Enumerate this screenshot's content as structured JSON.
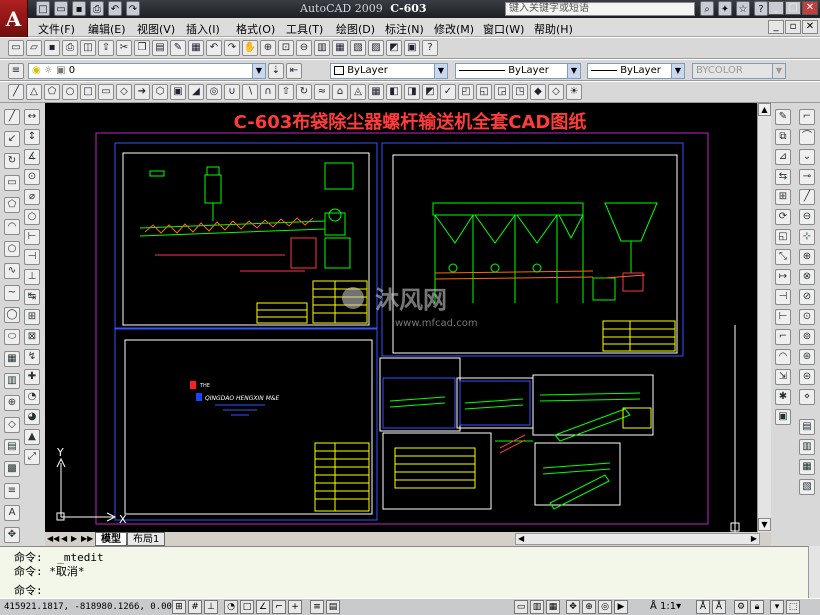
{
  "window": {
    "app_title": "AutoCAD 2009",
    "doc_title": "C-603",
    "search_placeholder": "键入关键字或短语",
    "logo": "A"
  },
  "menu": [
    "文件(F)",
    "编辑(E)",
    "视图(V)",
    "插入(I)",
    "格式(O)",
    "工具(T)",
    "绘图(D)",
    "标注(N)",
    "修改(M)",
    "窗口(W)",
    "帮助(H)"
  ],
  "layer_toolbar": {
    "layer_value": "0",
    "color_value": "ByLayer",
    "linetype_value": "ByLayer",
    "lineweight_value": "ByLayer",
    "plotstyle_value": "BYCOLOR"
  },
  "drawing": {
    "title": "C-603布袋除尘器螺杆输送机全套CAD图纸",
    "company": "QINGDAO HENGXIN M&E",
    "company_prefix": "THE",
    "watermark_brand": "沐风网",
    "watermark_url": "www.mfcad.com",
    "ucs_x": "X",
    "ucs_y": "Y",
    "colors": {
      "title": "#ff3b3b",
      "frame": "#c026c0",
      "sheet": "#ffffff",
      "geometry": "#00ff00",
      "table": "#ffff00",
      "blue": "#3355ff"
    }
  },
  "tabs": {
    "model": "模型",
    "layout1": "布局1"
  },
  "command": {
    "lines": [
      {
        "prompt": "命令:",
        "text": "_mtedit"
      },
      {
        "prompt": "命令:",
        "text": "*取消*"
      },
      {
        "prompt": "命令:",
        "text": ""
      }
    ]
  },
  "status": {
    "coords": "415921.1817, -818980.1266, 0.0000",
    "scale": "1:1"
  }
}
